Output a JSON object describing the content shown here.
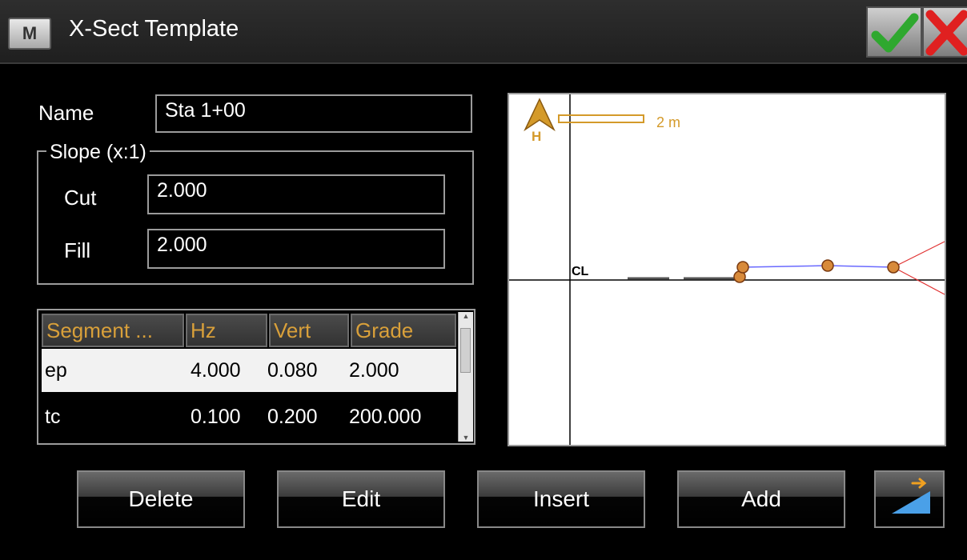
{
  "window": {
    "title": "X-Sect Template",
    "app_icon_letter": "M",
    "ok_icon": "checkmark-icon",
    "cancel_icon": "close-icon",
    "ok_color": "#2fa82f",
    "cancel_color": "#e02020"
  },
  "form": {
    "name_label": "Name",
    "name_value": "Sta 1+00",
    "slope_group_label": "Slope (x:1)",
    "cut_label": "Cut",
    "cut_value": "2.000",
    "fill_label": "Fill",
    "fill_value": "2.000"
  },
  "table": {
    "columns": [
      "Segment ...",
      "Hz",
      "Vert",
      "Grade"
    ],
    "rows": [
      {
        "segment": "ep",
        "hz": "4.000",
        "vert": "0.080",
        "grade": "2.000",
        "selected": true
      },
      {
        "segment": "tc",
        "hz": "0.100",
        "vert": "0.200",
        "grade": "200.000",
        "selected": false
      }
    ]
  },
  "preview": {
    "scale_label": "2 m",
    "north_label": "H",
    "centerline_label": "CL",
    "accent_color": "#d49a2a",
    "profile_color": "#6a6aff",
    "slope_color": "#e03030"
  },
  "buttons": {
    "delete": "Delete",
    "edit": "Edit",
    "insert": "Insert",
    "add": "Add",
    "icon_button": "slope-arrow-icon"
  }
}
